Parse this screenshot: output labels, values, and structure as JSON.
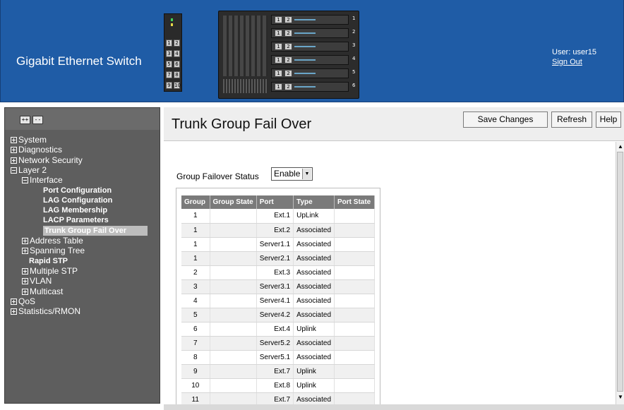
{
  "header": {
    "title": "Gigabit Ethernet Switch",
    "user_label": "User: user15",
    "sign_out_label": "Sign Out",
    "chassis_small_ports": [
      "1",
      "2",
      "3",
      "4",
      "5",
      "6",
      "7",
      "8",
      "9",
      "10"
    ],
    "chassis_bay_numbers": [
      "1",
      "2",
      "3",
      "4",
      "5",
      "6"
    ],
    "chassis_bay_ports": [
      "1",
      "2"
    ],
    "bg_color": "#1f5ca6"
  },
  "sidebar": {
    "expand_all_label": "++",
    "collapse_all_label": "--",
    "items": [
      {
        "label": "System",
        "toggle": "plus",
        "level": 0
      },
      {
        "label": "Diagnostics",
        "toggle": "plus",
        "level": 0
      },
      {
        "label": "Network Security",
        "toggle": "plus",
        "level": 0
      },
      {
        "label": "Layer 2",
        "toggle": "minus",
        "level": 0
      },
      {
        "label": "Interface",
        "toggle": "minus",
        "level": 1
      },
      {
        "label": "Port Configuration",
        "toggle": "none",
        "level": 2
      },
      {
        "label": "LAG Configuration",
        "toggle": "none",
        "level": 2
      },
      {
        "label": "LAG Membership",
        "toggle": "none",
        "level": 2
      },
      {
        "label": "LACP Parameters",
        "toggle": "none",
        "level": 2
      },
      {
        "label": "Trunk Group Fail Over",
        "toggle": "none",
        "level": 2,
        "selected": true
      },
      {
        "label": "Address Table",
        "toggle": "plus",
        "level": 1
      },
      {
        "label": "Spanning Tree",
        "toggle": "plus",
        "level": 1
      },
      {
        "label": "Rapid STP",
        "toggle": "none",
        "level": 1
      },
      {
        "label": "Multiple STP",
        "toggle": "plus",
        "level": 1
      },
      {
        "label": "VLAN",
        "toggle": "plus",
        "level": 1
      },
      {
        "label": "Multicast",
        "toggle": "plus",
        "level": 1
      },
      {
        "label": "QoS",
        "toggle": "plus",
        "level": 0
      },
      {
        "label": "Statistics/RMON",
        "toggle": "plus",
        "level": 0
      }
    ]
  },
  "main": {
    "page_title": "Trunk Group Fail Over",
    "buttons": {
      "save": "Save Changes",
      "refresh": "Refresh",
      "help": "Help"
    },
    "failover": {
      "label": "Group Failover Status",
      "value": "Enable"
    },
    "table": {
      "columns": [
        "Group",
        "Group State",
        "Port",
        "Type",
        "Port State"
      ],
      "rows": [
        {
          "group": "1",
          "group_state": "",
          "port": "Ext.1",
          "type": "UpLink",
          "port_state": ""
        },
        {
          "group": "1",
          "group_state": "",
          "port": "Ext.2",
          "type": "Associated",
          "port_state": ""
        },
        {
          "group": "1",
          "group_state": "",
          "port": "Server1.1",
          "type": "Associated",
          "port_state": ""
        },
        {
          "group": "1",
          "group_state": "",
          "port": "Server2.1",
          "type": "Associated",
          "port_state": ""
        },
        {
          "group": "2",
          "group_state": "",
          "port": "Ext.3",
          "type": "Associated",
          "port_state": ""
        },
        {
          "group": "3",
          "group_state": "",
          "port": "Server3.1",
          "type": "Associated",
          "port_state": ""
        },
        {
          "group": "4",
          "group_state": "",
          "port": "Server4.1",
          "type": "Associated",
          "port_state": ""
        },
        {
          "group": "5",
          "group_state": "",
          "port": "Server4.2",
          "type": "Associated",
          "port_state": ""
        },
        {
          "group": "6",
          "group_state": "",
          "port": "Ext.4",
          "type": "Uplink",
          "port_state": ""
        },
        {
          "group": "7",
          "group_state": "",
          "port": "Server5.2",
          "type": "Associated",
          "port_state": ""
        },
        {
          "group": "8",
          "group_state": "",
          "port": "Server5.1",
          "type": "Associated",
          "port_state": ""
        },
        {
          "group": "9",
          "group_state": "",
          "port": "Ext.7",
          "type": "Uplink",
          "port_state": ""
        },
        {
          "group": "10",
          "group_state": "",
          "port": "Ext.8",
          "type": "Uplink",
          "port_state": ""
        },
        {
          "group": "11",
          "group_state": "",
          "port": "Ext.7",
          "type": "Associated",
          "port_state": ""
        }
      ]
    }
  },
  "icons": {
    "scroll_up": "▲",
    "scroll_down": "▼",
    "dropdown": "▼"
  }
}
